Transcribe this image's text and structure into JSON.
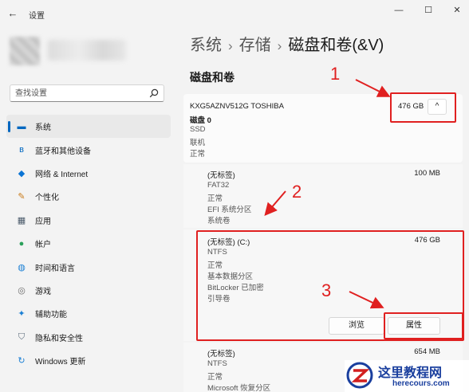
{
  "window": {
    "title": "设置",
    "back_glyph": "←",
    "min_glyph": "—",
    "max_glyph": "☐",
    "close_glyph": "✕"
  },
  "search": {
    "placeholder": "查找设置"
  },
  "nav": [
    {
      "label": "系统",
      "icon": "display-icon",
      "glyph": "▬",
      "color": "#0067c0",
      "active": true
    },
    {
      "label": "蓝牙和其他设备",
      "icon": "bluetooth-icon",
      "glyph": "ʙ",
      "color": "#0067c0"
    },
    {
      "label": "网络 & Internet",
      "icon": "wifi-icon",
      "glyph": "◆",
      "color": "#0a74d4"
    },
    {
      "label": "个性化",
      "icon": "brush-icon",
      "glyph": "✎",
      "color": "#c97b1a"
    },
    {
      "label": "应用",
      "icon": "apps-icon",
      "glyph": "▦",
      "color": "#4a5a6a"
    },
    {
      "label": "帐户",
      "icon": "account-icon",
      "glyph": "●",
      "color": "#2aa05a"
    },
    {
      "label": "时间和语言",
      "icon": "globe-icon",
      "glyph": "◍",
      "color": "#1a7fd4"
    },
    {
      "label": "游戏",
      "icon": "gamepad-icon",
      "glyph": "◎",
      "color": "#6a6a6a"
    },
    {
      "label": "辅助功能",
      "icon": "accessibility-icon",
      "glyph": "✦",
      "color": "#1a7fd4"
    },
    {
      "label": "隐私和安全性",
      "icon": "shield-icon",
      "glyph": "⛉",
      "color": "#5a6a7a"
    },
    {
      "label": "Windows 更新",
      "icon": "update-icon",
      "glyph": "↻",
      "color": "#1a7fd4"
    }
  ],
  "breadcrumb": [
    "系统",
    "存储",
    "磁盘和卷(&V)"
  ],
  "breadcrumb_sep": "›",
  "section_title": "磁盘和卷",
  "disk": {
    "model": "KXG5AZNV512G TOSHIBA",
    "name": "磁盘 0",
    "lines": [
      "SSD",
      "联机",
      "正常"
    ],
    "size": "476 GB",
    "chevron": "^"
  },
  "volumes": [
    {
      "lines": [
        "(无标签)",
        "FAT32",
        "正常",
        "EFI 系统分区",
        "系统卷"
      ],
      "size": "100 MB"
    },
    {
      "lines": [
        "(无标签) (C:)",
        "NTFS",
        "正常",
        "基本数据分区",
        "BitLocker 已加密",
        "引导卷"
      ],
      "size": "476 GB",
      "browse": "浏览",
      "properties": "属性"
    },
    {
      "lines": [
        "(无标签)",
        "NTFS",
        "正常",
        "Microsoft 恢复分区"
      ],
      "size": "654 MB"
    }
  ],
  "annotations": [
    "1",
    "2",
    "3"
  ],
  "watermark": {
    "title": "这里教程网",
    "url": "herecours.com"
  },
  "colors": {
    "accent": "#0067c0",
    "annotation": "#e02020",
    "watermark": "#1a3f9e"
  }
}
